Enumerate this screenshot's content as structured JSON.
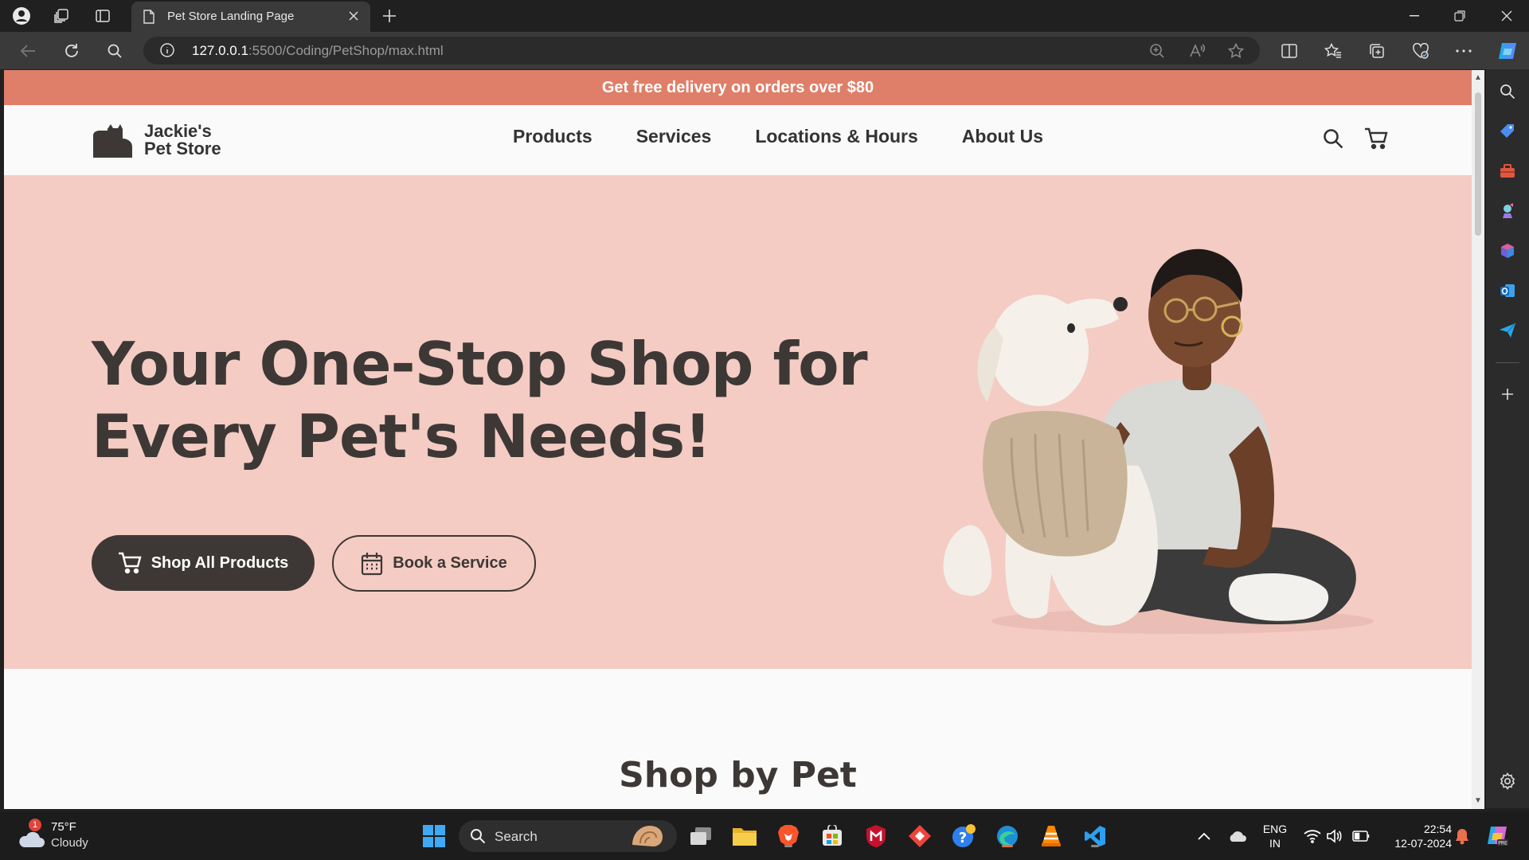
{
  "browser": {
    "tab_title": "Pet Store Landing Page",
    "url_host": "127.0.0.1",
    "url_path": ":5500/Coding/PetShop/max.html"
  },
  "site": {
    "promo_text": "Get free delivery on orders over $80",
    "brand_line1": "Jackie's",
    "brand_line2": "Pet Store",
    "nav": [
      "Products",
      "Services",
      "Locations & Hours",
      "About Us"
    ],
    "hero_title_line1": "Your One-Stop Shop for",
    "hero_title_line2": "Every Pet's Needs!",
    "primary_cta": "Shop All Products",
    "secondary_cta": "Book a Service",
    "section_title": "Shop by Pet",
    "colors": {
      "promo": "#df7f69",
      "hero_bg": "#f4ccc3",
      "dark": "#3d3835"
    }
  },
  "taskbar": {
    "weather_temp": "75°F",
    "weather_cond": "Cloudy",
    "weather_badge": "1",
    "search_label": "Search",
    "lang_line1": "ENG",
    "lang_line2": "IN",
    "time": "22:54",
    "date": "12-07-2024"
  }
}
